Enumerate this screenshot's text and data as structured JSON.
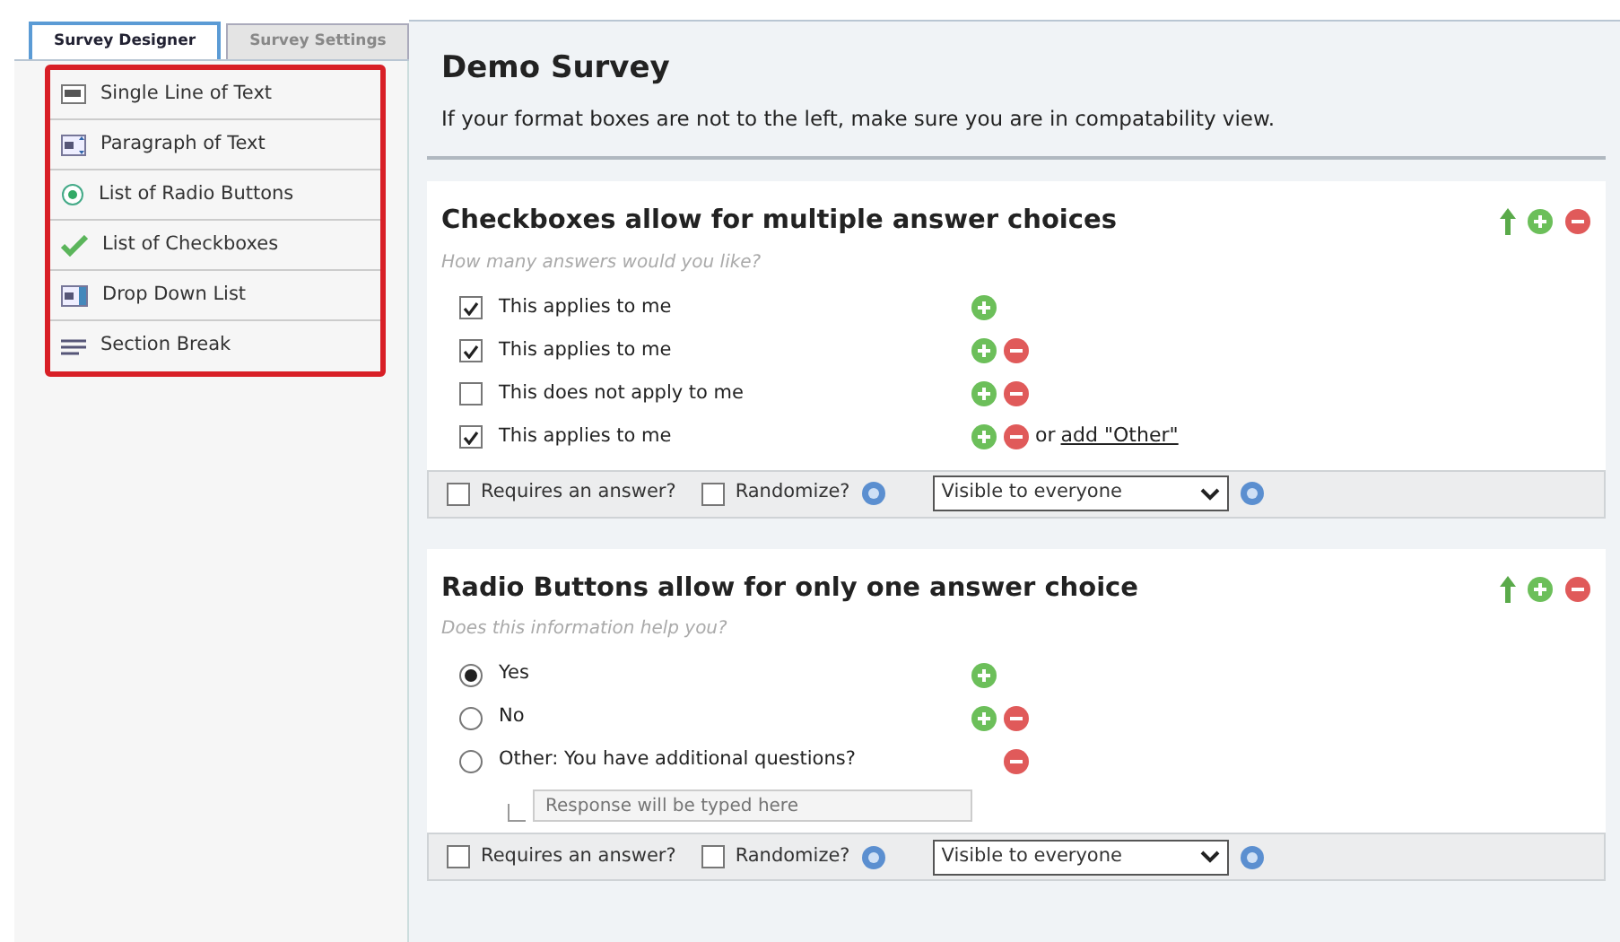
{
  "tabs": [
    {
      "label": "Survey Designer",
      "selected": true
    },
    {
      "label": "Survey Settings",
      "selected": false
    }
  ],
  "toolbox": {
    "items": [
      {
        "label": "Single Line of Text",
        "kind": "textbox"
      },
      {
        "label": "Paragraph of Text",
        "kind": "paragraph"
      },
      {
        "label": "List of Radio Buttons",
        "kind": "radio"
      },
      {
        "label": "List of Checkboxes",
        "kind": "check"
      },
      {
        "label": "Drop Down List",
        "kind": "dropdown"
      },
      {
        "label": "Section Break",
        "kind": "break"
      }
    ]
  },
  "survey": {
    "title": "Demo Survey",
    "subtitle": "If your format boxes are not to the left, make sure you are in compatability view."
  },
  "questions": [
    {
      "kind": "checkbox",
      "title": "Checkboxes allow for multiple answer choices",
      "hint": "How many answers would you like?",
      "options": [
        {
          "label": "This applies to me",
          "checked": true,
          "add": true,
          "remove": false
        },
        {
          "label": "This applies to me",
          "checked": true,
          "add": true,
          "remove": true
        },
        {
          "label": "This does not apply to me",
          "checked": false,
          "add": true,
          "remove": true
        },
        {
          "label": "This applies to me",
          "checked": true,
          "add": true,
          "remove": true,
          "or_text": "or",
          "link": "add \"Other\""
        }
      ],
      "footer": {
        "requires": {
          "label": "Requires an answer?",
          "checked": false
        },
        "randomize": {
          "label": "Randomize?",
          "checked": false
        },
        "visibility": "Visible to everyone"
      }
    },
    {
      "kind": "radio",
      "title": "Radio Buttons allow for only one answer choice",
      "hint": "Does this information help you?",
      "options": [
        {
          "label": "Yes",
          "selected": true,
          "add": true,
          "remove": false
        },
        {
          "label": "No",
          "selected": false,
          "add": true,
          "remove": true
        },
        {
          "label": "Other: You have additional questions?",
          "selected": false,
          "add": false,
          "remove": true,
          "placeholder": "Response will be typed here"
        }
      ],
      "footer": {
        "requires": {
          "label": "Requires an answer?",
          "checked": false
        },
        "randomize": {
          "label": "Randomize?",
          "checked": false
        },
        "visibility": "Visible to everyone"
      }
    }
  ]
}
